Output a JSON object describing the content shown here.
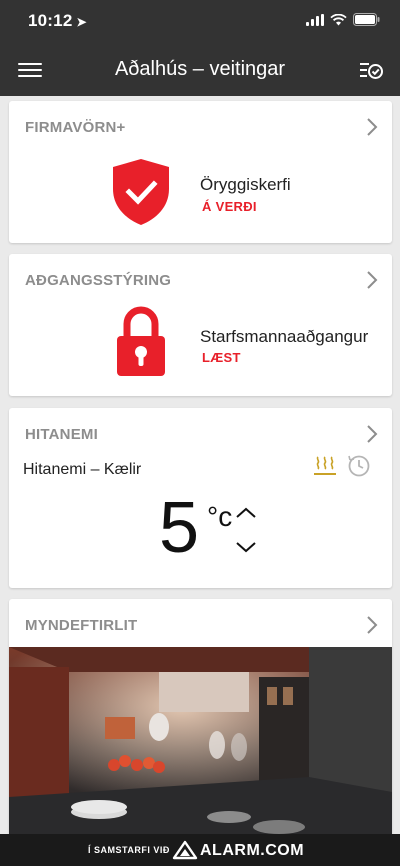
{
  "status_bar": {
    "time": "10:12",
    "location_arrow": "➤"
  },
  "nav": {
    "title": "Aðalhús – veitingar",
    "menu_icon": "hamburger-icon",
    "tasks_icon": "checklist-icon"
  },
  "cards": {
    "firmavorn": {
      "title": "FIRMAVÖRN+",
      "item_label": "Öryggiskerfi",
      "item_status": "Á VERÐI",
      "icon": "shield-check-icon"
    },
    "access": {
      "title": "AÐGANGSSTÝRING",
      "item_label": "Starfsmannaaðgangur",
      "item_status": "LÆST",
      "icon": "padlock-icon"
    },
    "thermostat": {
      "title": "HITANEMI",
      "device_name": "Hitanemi – Kælir",
      "temperature": "5",
      "unit": "°c",
      "mode_icon": "heat-icon",
      "schedule_icon": "schedule-icon"
    },
    "camera": {
      "title": "MYNDEFTIRLIT"
    }
  },
  "footer": {
    "partner_text": "Í SAMSTARFI VIÐ",
    "brand": "ALARM.COM"
  },
  "colors": {
    "accent_red": "#e8202a",
    "bar_dark": "#333333",
    "heat_gold": "#c9a227"
  }
}
